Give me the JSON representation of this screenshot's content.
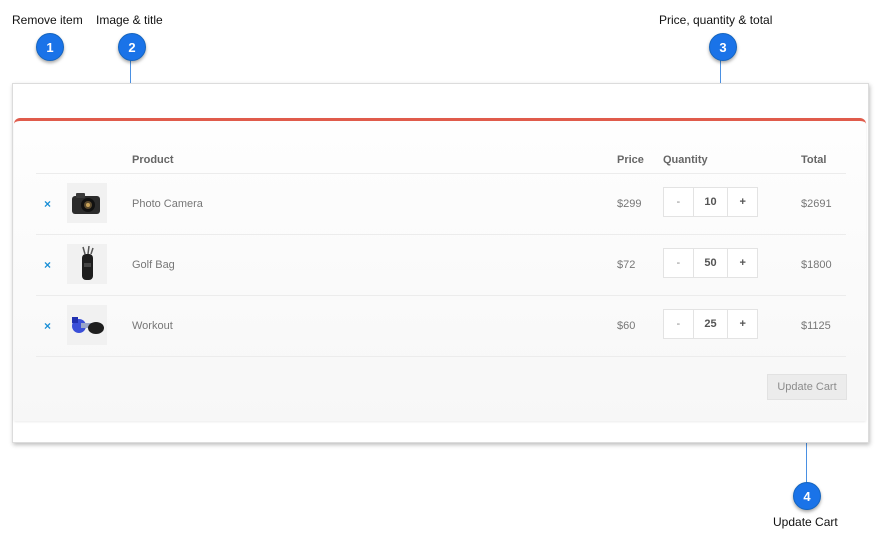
{
  "callouts": [
    {
      "number": "1",
      "label": "Remove item"
    },
    {
      "number": "2",
      "label": "Image & title"
    },
    {
      "number": "3",
      "label": "Price, quantity & total"
    },
    {
      "number": "4",
      "label": "Update Cart"
    }
  ],
  "cart": {
    "headers": {
      "product": "Product",
      "price": "Price",
      "quantity": "Quantity",
      "total": "Total"
    },
    "remove_icon": "×",
    "items": [
      {
        "name": "Photo Camera",
        "price": "$299",
        "qty": "10",
        "total": "$2691",
        "icon": "camera-icon"
      },
      {
        "name": "Golf Bag",
        "price": "$72",
        "qty": "50",
        "total": "$1800",
        "icon": "golf-bag-icon"
      },
      {
        "name": "Workout",
        "price": "$60",
        "qty": "25",
        "total": "$1125",
        "icon": "dumbbell-icon"
      }
    ],
    "decrement": "-",
    "increment": "+",
    "update_label": "Update Cart"
  },
  "colors": {
    "accent_bar": "#e05b4b",
    "callout": "#1a73e8",
    "remove": "#1a8fd6"
  }
}
